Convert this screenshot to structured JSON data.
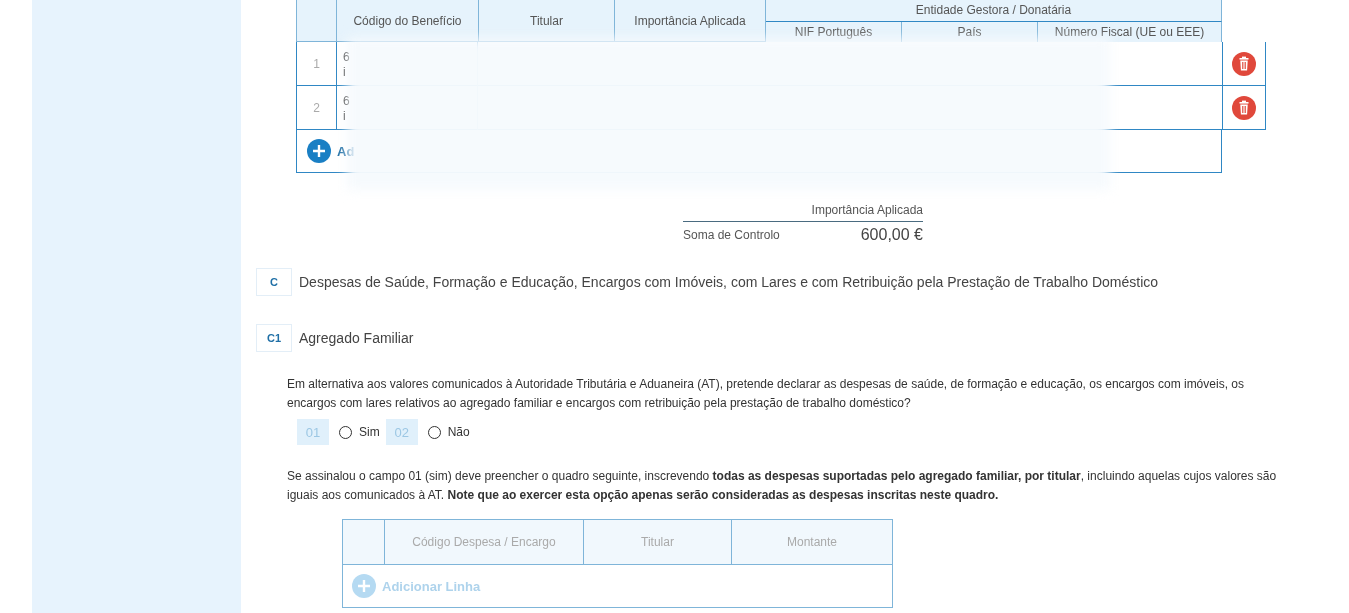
{
  "benefits_table": {
    "columns": [
      "Código do Benefício",
      "Titular",
      "Importância Aplicada"
    ],
    "group_header": "Entidade Gestora / Donatária",
    "group_columns": [
      "NIF Português",
      "País",
      "Número Fiscal (UE ou EEE)"
    ],
    "rows": [
      {
        "number": "1",
        "code_line_1": "6",
        "code_line_2": "i"
      },
      {
        "number": "2",
        "code_line_1": "6",
        "code_line_2": "i"
      }
    ],
    "add_button": {
      "label": "Ad",
      "disabled": false
    }
  },
  "control_sum": {
    "column_label": "Importância Aplicada",
    "label": "Soma de Controlo",
    "value": "600,00 €"
  },
  "sections": [
    {
      "code": "C",
      "title": "Despesas de Saúde, Formação e Educação, Encargos com Imóveis, com Lares e com Retribuição pela Prestação de Trabalho Doméstico"
    },
    {
      "code": "C1",
      "title": "Agregado Familiar"
    }
  ],
  "question": "Em alternativa aos valores comunicados à Autoridade Tributária e Aduaneira (AT), pretende declarar as despesas de saúde, de formação e educação, os encargos com imóveis, os encargos com lares relativos ao agregado familiar e encargos com retribuição pela prestação de trabalho doméstico?",
  "options": [
    {
      "field": "01",
      "label": "Sim",
      "selected": false
    },
    {
      "field": "02",
      "label": "Não",
      "selected": false
    }
  ],
  "instruction": "Se assinalou o campo 01 (sim) deve preencher o quadro seguinte, inscrevendo **todas as despesas suportadas pelo agregado familiar, por titular**, incluindo aquelas cujos valores são iguais aos comunicados à AT. **Note que ao exercer esta opção apenas serão consideradas as despesas inscritas neste quadro.**",
  "expenses_table": {
    "columns": [
      "Código Despesa / Encargo",
      "Titular",
      "Montante"
    ],
    "add_button": {
      "label": "Adicionar Linha",
      "disabled": true
    }
  }
}
